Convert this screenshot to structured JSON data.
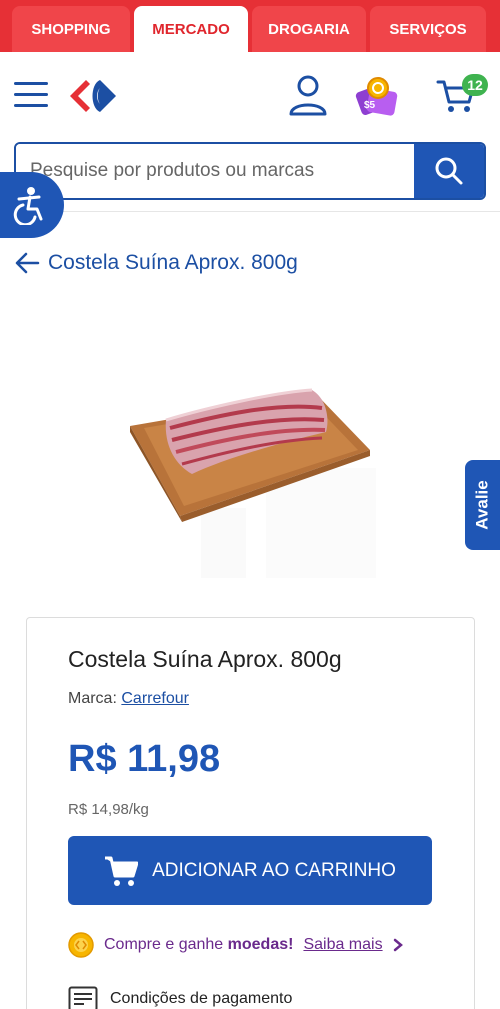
{
  "tabs": [
    {
      "label": "SHOPPING",
      "active": false
    },
    {
      "label": "MERCADO",
      "active": true
    },
    {
      "label": "DROGARIA",
      "active": false
    },
    {
      "label": "SERVIÇOS",
      "active": false
    }
  ],
  "header": {
    "icons": [
      "menu-icon",
      "carrefour-logo",
      "user-icon",
      "coupon-coins-icon",
      "cart-icon"
    ],
    "cart_count": "12"
  },
  "search": {
    "placeholder": "Pesquise por produtos ou marcas",
    "value": ""
  },
  "product": {
    "page_title": "Costela Suína Aprox. 800g",
    "name": "Costela Suína Aprox. 800g",
    "brand_label": "Marca:",
    "brand": "Carrefour",
    "price": "R$ 11,98",
    "unit_price": "R$ 14,98/kg",
    "add_to_cart": "ADICIONAR AO CARRINHO"
  },
  "coins": {
    "text": "Compre e ganhe",
    "highlight": "moedas!",
    "link": "Saiba mais"
  },
  "payment": {
    "label": "Condições de pagamento"
  },
  "avalie": "Avalie",
  "colors": {
    "brand_red": "#e63036",
    "brand_blue": "#1f56b5",
    "badge_green": "#3fb34f",
    "coins_purple": "#6a2a8c"
  }
}
